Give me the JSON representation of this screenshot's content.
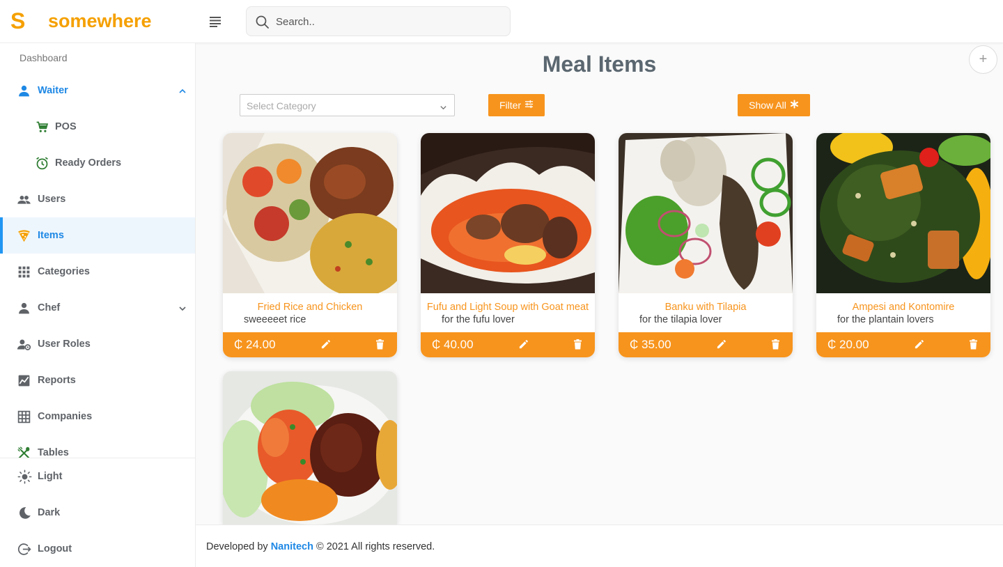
{
  "brand": {
    "letter": "S",
    "name": "somewhere"
  },
  "search": {
    "placeholder": "Search.."
  },
  "sidebar": {
    "heading": "Dashboard",
    "items": [
      {
        "label": "Waiter",
        "icon": "person-icon"
      },
      {
        "label": "POS",
        "icon": "cart-icon"
      },
      {
        "label": "Ready Orders",
        "icon": "alarm-icon"
      },
      {
        "label": "Users",
        "icon": "people-icon"
      },
      {
        "label": "Items",
        "icon": "pizza-icon"
      },
      {
        "label": "Categories",
        "icon": "grid-icon"
      },
      {
        "label": "Chef",
        "icon": "person-icon"
      },
      {
        "label": "User Roles",
        "icon": "user-roles-icon"
      },
      {
        "label": "Reports",
        "icon": "chart-icon"
      },
      {
        "label": "Companies",
        "icon": "table-icon"
      },
      {
        "label": "Tables",
        "icon": "utensils-icon"
      }
    ],
    "bottom": [
      {
        "label": "Light",
        "icon": "sun-icon"
      },
      {
        "label": "Dark",
        "icon": "moon-icon"
      },
      {
        "label": "Logout",
        "icon": "logout-icon"
      }
    ]
  },
  "main": {
    "title": "Meal Items",
    "select_placeholder": "Select Category",
    "filter_label": "Filter",
    "show_all_label": "Show All",
    "add_symbol": "+"
  },
  "meals": [
    {
      "name": "Fried Rice and Chicken",
      "description": "sweeeeet rice",
      "price": "₵ 24.00"
    },
    {
      "name": "Fufu and Light Soup with Goat meat",
      "description": "for the fufu lover",
      "price": "₵ 40.00"
    },
    {
      "name": "Banku with Tilapia",
      "description": "for the tilapia lover",
      "price": "₵ 35.00"
    },
    {
      "name": "Ampesi and Kontomire",
      "description": "for the plantain lovers",
      "price": "₵ 20.00"
    }
  ],
  "footer": {
    "prefix": "Developed by",
    "company": "Nanitech",
    "suffix": "© 2021 All rights reserved."
  },
  "colors": {
    "accent": "#f7941d",
    "brand": "#f5a000",
    "active": "#1e88e5"
  }
}
